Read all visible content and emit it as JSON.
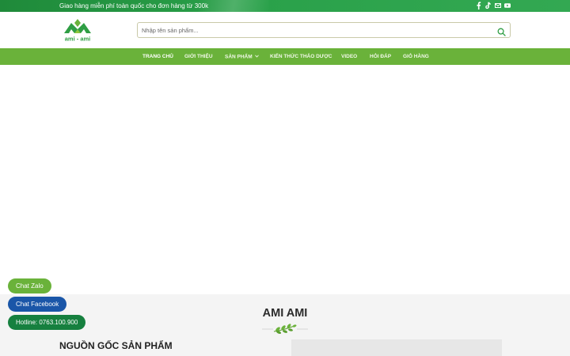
{
  "topbar": {
    "promo": "Giao hàng miễn phí toàn quốc cho đơn hàng từ 300k",
    "social_icons": [
      "facebook-icon",
      "tiktok-icon",
      "email-icon",
      "youtube-icon"
    ]
  },
  "header": {
    "logo_text": "ami - ami",
    "search": {
      "placeholder": "Nhập tên sản phẩm..."
    }
  },
  "nav": {
    "items": [
      {
        "label": "TRANG CHỦ"
      },
      {
        "label": "GIỚI THIỆU"
      },
      {
        "label": "SẢN PHẨM"
      },
      {
        "label": "KIẾN THỨC THẢO DƯỢC"
      },
      {
        "label": "VIDEO"
      },
      {
        "label": "HỎI ĐÁP"
      },
      {
        "label": "GIỎ HÀNG"
      }
    ]
  },
  "section": {
    "title": "AMI AMI",
    "heading": "NGUỒN GỐC SẢN PHẨM"
  },
  "chat": {
    "zalo": "Chat Zalo",
    "facebook": "Chat Facebook",
    "hotline": "Hotline: 0763.100.900"
  },
  "colors": {
    "brand_green": "#6ab23a",
    "topbar_green": "#2aa14a",
    "facebook_blue": "#1a56a8",
    "hotline_green": "#16803f"
  }
}
